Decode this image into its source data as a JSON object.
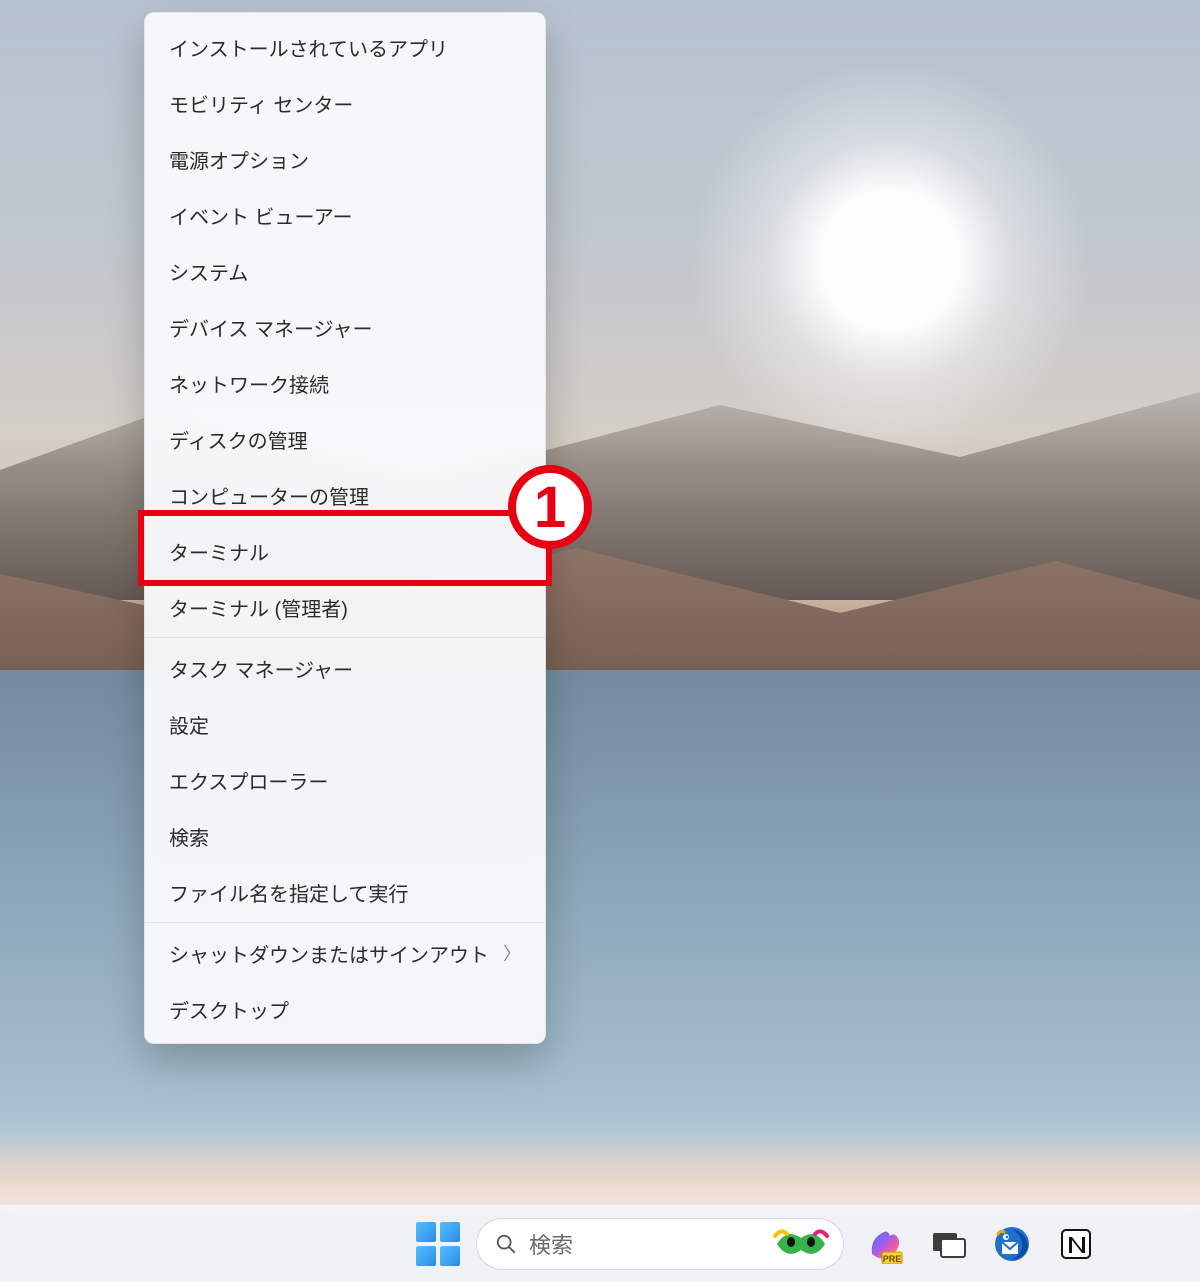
{
  "menu": {
    "items": [
      {
        "id": "installed-apps",
        "label": "インストールされているアプリ",
        "submenu": false
      },
      {
        "id": "mobility-center",
        "label": "モビリティ センター",
        "submenu": false
      },
      {
        "id": "power-options",
        "label": "電源オプション",
        "submenu": false
      },
      {
        "id": "event-viewer",
        "label": "イベント ビューアー",
        "submenu": false
      },
      {
        "id": "system",
        "label": "システム",
        "submenu": false
      },
      {
        "id": "device-manager",
        "label": "デバイス マネージャー",
        "submenu": false
      },
      {
        "id": "network-connections",
        "label": "ネットワーク接続",
        "submenu": false
      },
      {
        "id": "disk-management",
        "label": "ディスクの管理",
        "submenu": false
      },
      {
        "id": "computer-management",
        "label": "コンピューターの管理",
        "submenu": false
      },
      {
        "id": "terminal",
        "label": "ターミナル",
        "submenu": false
      },
      {
        "id": "terminal-admin",
        "label": "ターミナル (管理者)",
        "submenu": false
      },
      {
        "id": "task-manager",
        "label": "タスク マネージャー",
        "submenu": false
      },
      {
        "id": "settings",
        "label": "設定",
        "submenu": false
      },
      {
        "id": "file-explorer",
        "label": "エクスプローラー",
        "submenu": false
      },
      {
        "id": "search",
        "label": "検索",
        "submenu": false
      },
      {
        "id": "run",
        "label": "ファイル名を指定して実行",
        "submenu": false
      },
      {
        "id": "shutdown-signout",
        "label": "シャットダウンまたはサインアウト",
        "submenu": true
      },
      {
        "id": "desktop",
        "label": "デスクトップ",
        "submenu": false
      }
    ],
    "separators_after_index": [
      10,
      15
    ]
  },
  "callout": {
    "number": "1"
  },
  "taskbar": {
    "search_placeholder": "検索",
    "icons": [
      {
        "id": "start",
        "name": "start-button"
      },
      {
        "id": "search",
        "name": "search-box"
      },
      {
        "id": "copilot-pre",
        "name": "copilot-preview-icon"
      },
      {
        "id": "task-view",
        "name": "task-view-icon"
      },
      {
        "id": "thunderbird",
        "name": "thunderbird-icon"
      },
      {
        "id": "notion",
        "name": "notion-icon"
      }
    ]
  },
  "colors": {
    "callout_red": "#e70012"
  }
}
